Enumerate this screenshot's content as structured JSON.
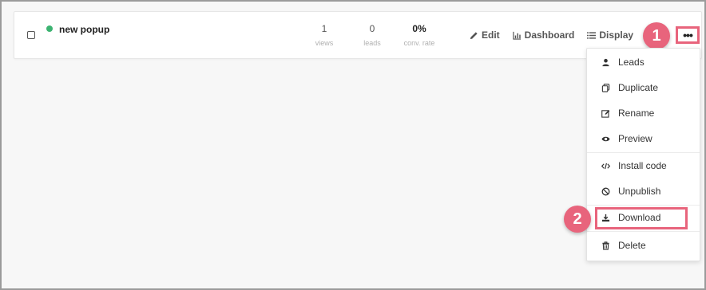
{
  "row": {
    "name": "new popup",
    "stats": [
      {
        "value": "1",
        "label": "views"
      },
      {
        "value": "0",
        "label": "leads"
      },
      {
        "value": "0%",
        "label": "conv. rate"
      }
    ],
    "actions": {
      "edit": "Edit",
      "dashboard": "Dashboard",
      "display": "Display"
    },
    "more_icon": "ellipsis-icon",
    "status_color": "#3cb371"
  },
  "menu": {
    "items": [
      {
        "label": "Leads",
        "icon": "user-icon"
      },
      {
        "label": "Duplicate",
        "icon": "copy-icon"
      },
      {
        "label": "Rename",
        "icon": "edit-icon"
      },
      {
        "label": "Preview",
        "icon": "eye-icon"
      },
      {
        "label": "Install code",
        "icon": "code-icon"
      },
      {
        "label": "Unpublish",
        "icon": "ban-icon"
      },
      {
        "label": "Download",
        "icon": "download-icon"
      },
      {
        "label": "Delete",
        "icon": "trash-icon"
      }
    ]
  },
  "annotations": {
    "step1": "1",
    "step2": "2",
    "highlight_color": "#e8647c"
  }
}
